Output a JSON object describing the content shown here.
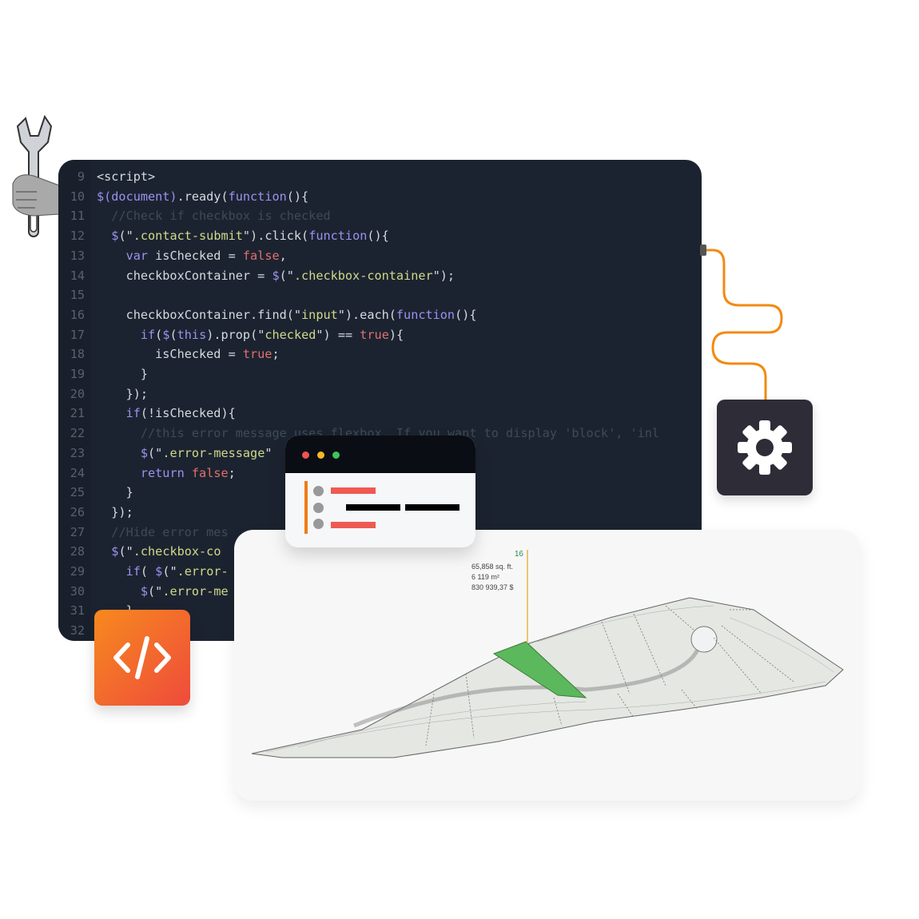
{
  "code_editor": {
    "lines": [
      {
        "n": "9",
        "tokens": [
          [
            "pl",
            "<script>"
          ]
        ]
      },
      {
        "n": "10",
        "tokens": [
          [
            "kw",
            "$(document)"
          ],
          [
            "pl",
            ".ready("
          ],
          [
            "kw",
            "function"
          ],
          [
            "pl",
            "(){"
          ]
        ]
      },
      {
        "n": "11",
        "tokens": [
          [
            "pl",
            "  "
          ],
          [
            "cm",
            "//Check if checkbox is checked"
          ]
        ]
      },
      {
        "n": "12",
        "tokens": [
          [
            "pl",
            "  "
          ],
          [
            "kw",
            "$"
          ],
          [
            "pl",
            "(\""
          ],
          [
            "st",
            ".contact-submit"
          ],
          [
            "pl",
            "\").click("
          ],
          [
            "kw",
            "function"
          ],
          [
            "pl",
            "(){"
          ]
        ]
      },
      {
        "n": "13",
        "tokens": [
          [
            "pl",
            "    "
          ],
          [
            "kw",
            "var"
          ],
          [
            "pl",
            " isChecked = "
          ],
          [
            "rd",
            "false"
          ],
          [
            "pl",
            ","
          ]
        ]
      },
      {
        "n": "14",
        "tokens": [
          [
            "pl",
            "    checkboxContainer = "
          ],
          [
            "kw",
            "$"
          ],
          [
            "pl",
            "(\""
          ],
          [
            "st",
            ".checkbox-container"
          ],
          [
            "pl",
            "\");"
          ]
        ]
      },
      {
        "n": "15",
        "tokens": []
      },
      {
        "n": "16",
        "tokens": [
          [
            "pl",
            "    checkboxContainer.find(\""
          ],
          [
            "st",
            "input"
          ],
          [
            "pl",
            "\").each("
          ],
          [
            "kw",
            "function"
          ],
          [
            "pl",
            "(){"
          ]
        ]
      },
      {
        "n": "17",
        "tokens": [
          [
            "pl",
            "      "
          ],
          [
            "kw",
            "if"
          ],
          [
            "pl",
            "("
          ],
          [
            "kw",
            "$"
          ],
          [
            "pl",
            "("
          ],
          [
            "kw",
            "this"
          ],
          [
            "pl",
            ").prop(\""
          ],
          [
            "st",
            "checked"
          ],
          [
            "pl",
            "\") == "
          ],
          [
            "rd",
            "true"
          ],
          [
            "pl",
            "){"
          ]
        ]
      },
      {
        "n": "18",
        "tokens": [
          [
            "pl",
            "        isChecked = "
          ],
          [
            "rd",
            "true"
          ],
          [
            "pl",
            ";"
          ]
        ]
      },
      {
        "n": "19",
        "tokens": [
          [
            "pl",
            "      }"
          ]
        ]
      },
      {
        "n": "20",
        "tokens": [
          [
            "pl",
            "    });"
          ]
        ]
      },
      {
        "n": "21",
        "tokens": [
          [
            "pl",
            "    "
          ],
          [
            "kw",
            "if"
          ],
          [
            "pl",
            "(!isChecked){"
          ]
        ]
      },
      {
        "n": "22",
        "tokens": [
          [
            "pl",
            "      "
          ],
          [
            "cm",
            "//this error message uses flexbox. If you want to display 'block', 'inl"
          ]
        ]
      },
      {
        "n": "23",
        "tokens": [
          [
            "pl",
            "      "
          ],
          [
            "kw",
            "$"
          ],
          [
            "pl",
            "(\""
          ],
          [
            "st",
            ".error-message"
          ],
          [
            "pl",
            "\""
          ]
        ]
      },
      {
        "n": "24",
        "tokens": [
          [
            "pl",
            "      "
          ],
          [
            "kw",
            "return"
          ],
          [
            "pl",
            " "
          ],
          [
            "rd",
            "false"
          ],
          [
            "pl",
            ";"
          ]
        ]
      },
      {
        "n": "25",
        "tokens": [
          [
            "pl",
            "    }"
          ]
        ]
      },
      {
        "n": "26",
        "tokens": [
          [
            "pl",
            "  });"
          ]
        ]
      },
      {
        "n": "27",
        "tokens": [
          [
            "pl",
            "  "
          ],
          [
            "cm",
            "//Hide error mes"
          ]
        ]
      },
      {
        "n": "28",
        "tokens": [
          [
            "pl",
            "  "
          ],
          [
            "kw",
            "$"
          ],
          [
            "pl",
            "(\""
          ],
          [
            "st",
            ".checkbox-co"
          ]
        ]
      },
      {
        "n": "29",
        "tokens": [
          [
            "pl",
            "    "
          ],
          [
            "kw",
            "if"
          ],
          [
            "pl",
            "( "
          ],
          [
            "kw",
            "$"
          ],
          [
            "pl",
            "(\""
          ],
          [
            "st",
            ".error-"
          ]
        ]
      },
      {
        "n": "30",
        "tokens": [
          [
            "pl",
            "      "
          ],
          [
            "kw",
            "$"
          ],
          [
            "pl",
            "(\""
          ],
          [
            "st",
            ".error-me"
          ]
        ]
      },
      {
        "n": "31",
        "tokens": [
          [
            "pl",
            "    }"
          ]
        ]
      },
      {
        "n": "32",
        "tokens": []
      }
    ]
  },
  "icons": {
    "wrench": "wrench-in-hand-icon",
    "gear": "gear-icon",
    "code": "code-brackets-icon"
  },
  "browser_window": {
    "dots": [
      "#ee5452",
      "#f5b928",
      "#3dc55a"
    ],
    "accent": "#f07b14"
  },
  "map": {
    "lot_number": "16",
    "area_sqft": "65,858 sq. ft.",
    "area_m2": "6 119 m²",
    "price": "830 939,37 $",
    "highlight_color": "#5cb85c",
    "marker_color": "#e8b347"
  },
  "colors": {
    "editor_bg": "#1c2330",
    "wire": "#f38a12",
    "code_card_gradient": [
      "#f7891e",
      "#ee4b3c"
    ]
  }
}
